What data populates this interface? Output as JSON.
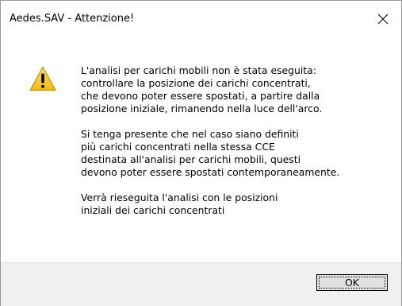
{
  "window": {
    "title": "Aedes.SAV - Attenzione!"
  },
  "icon": {
    "name": "warning-icon",
    "color": "#f5c518"
  },
  "message": {
    "paragraphs": [
      "L'analisi per carichi mobili non è stata eseguita:\ncontrollare la posizione dei carichi concentrati,\nche devono poter essere spostati, a partire dalla\nposizione iniziale, rimanendo nella luce dell'arco.",
      "Si tenga presente che nel caso siano definiti\npiù carichi concentrati nella stessa CCE\ndestinata all'analisi per carichi mobili, questi\ndevono poter essere spostati contemporaneamente.",
      "Verrà rieseguita l'analisi con le posizioni\niniziali dei carichi concentrati"
    ]
  },
  "buttons": {
    "ok_label": "OK"
  }
}
